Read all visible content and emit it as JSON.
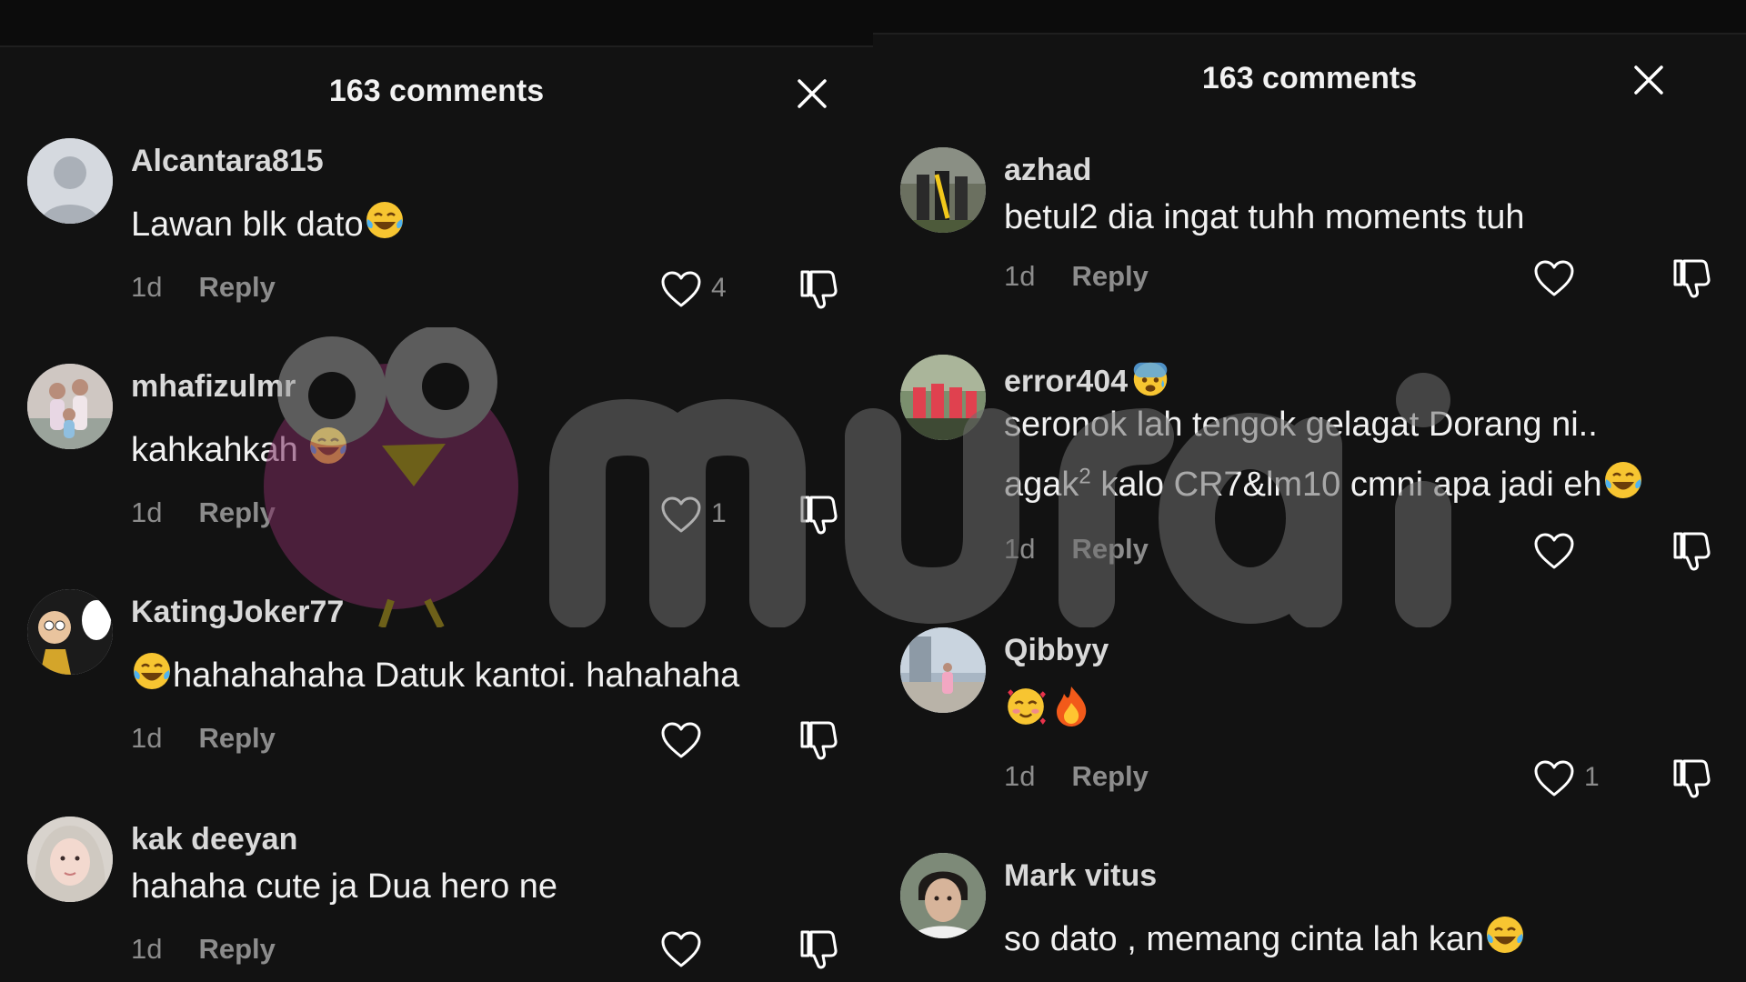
{
  "left_panel": {
    "title": "163 comments",
    "comments": [
      {
        "username": "Alcantara815",
        "text": "Lawan blk dato",
        "time": "1d",
        "reply": "Reply",
        "likes": "4"
      },
      {
        "username": "mhafizulmr",
        "text": "kahkahkah ",
        "time": "1d",
        "reply": "Reply",
        "likes": "1"
      },
      {
        "username": "KatingJoker77",
        "text": "hahahahaha Datuk kantoi. hahahaha",
        "time": "1d",
        "reply": "Reply",
        "likes": ""
      },
      {
        "username": "kak deeyan",
        "text": "hahaha cute ja Dua hero ne",
        "time": "1d",
        "reply": "Reply",
        "likes": ""
      }
    ]
  },
  "right_panel": {
    "title": "163 comments",
    "comments": [
      {
        "username": "azhad",
        "text": "betul2 dia ingat tuhh moments tuh",
        "time": "1d",
        "reply": "Reply",
        "likes": ""
      },
      {
        "username": "error404",
        "text_line1": "seronok lah tengok gelagat Dorang ni..",
        "text_line2_a": "agak",
        "text_line2_sup": "2",
        "text_line2_b": " kalo CR7&lm10 cmni apa jadi eh",
        "time": "1d",
        "reply": "Reply",
        "likes": ""
      },
      {
        "username": "Qibbyy",
        "text": "",
        "time": "1d",
        "reply": "Reply",
        "likes": "1"
      },
      {
        "username": "Mark vitus",
        "text": "so dato , memang cinta lah kan"
      }
    ]
  },
  "icons": {
    "close": "close-icon",
    "like": "heart-icon",
    "dislike": "thumbs-down-icon",
    "laugh": "tears-of-joy-emoji",
    "fear": "anxious-face-emoji",
    "love": "smiling-face-with-hearts-emoji",
    "fire": "fire-emoji"
  },
  "colors": {
    "background": "#121212",
    "text": "#f1f1f1",
    "muted": "#8c8c8c",
    "watermark": "#7a2a5e"
  }
}
